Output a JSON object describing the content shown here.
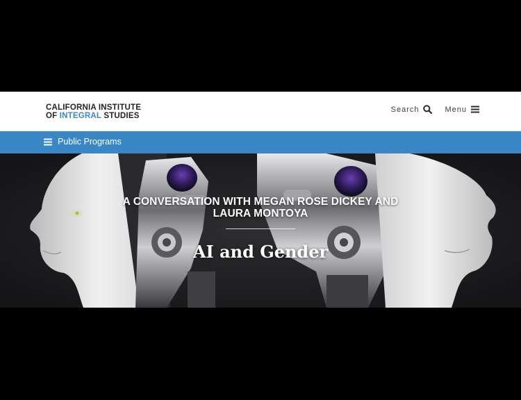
{
  "header": {
    "logo_line1": "CALIFORNIA INSTITUTE",
    "logo_line2_prefix": "OF ",
    "logo_line2_accent": "INTEGRAL",
    "logo_line2_suffix": " STUDIES",
    "search_label": "Search",
    "menu_label": "Menu"
  },
  "subnav": {
    "label": "Public Programs"
  },
  "hero": {
    "kicker": "A CONVERSATION WITH MEGAN ROSE DICKEY AND LAURA MONTOYA",
    "title": "AI and Gender"
  },
  "colors": {
    "accent": "#3a87c6",
    "background": "#000000",
    "header_bg": "#ffffff"
  },
  "icons": {
    "search": "search-icon",
    "menu": "hamburger-icon",
    "subnav": "hamburger-icon"
  }
}
